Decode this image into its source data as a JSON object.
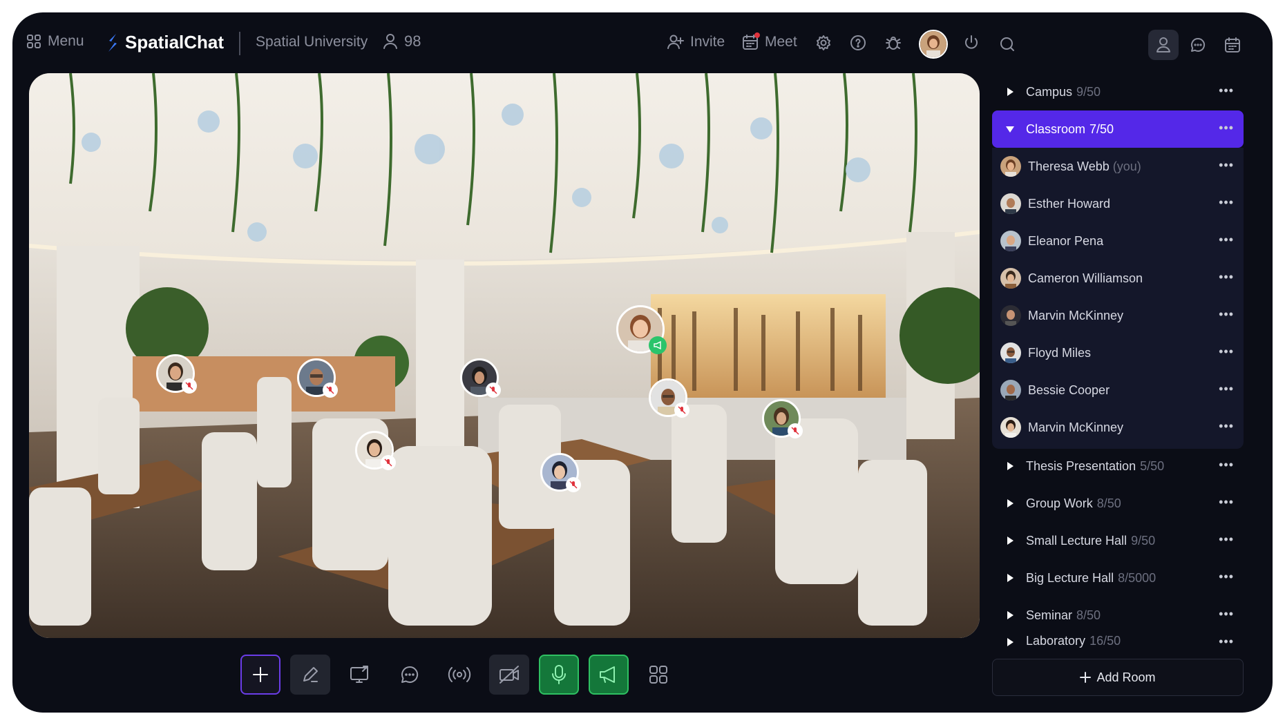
{
  "topbar": {
    "menu_label": "Menu",
    "brand": "SpatialChat",
    "space_name": "Spatial University",
    "participant_count": "98",
    "invite_label": "Invite",
    "meet_label": "Meet"
  },
  "icons": {
    "menu": "grid-icon",
    "brand": "spatialchat-logo-icon",
    "participants": "user-icon",
    "invite": "user-plus-icon",
    "meet": "calendar-icon",
    "settings": "gear-icon",
    "help": "help-icon",
    "bug": "bug-icon",
    "power": "power-icon",
    "search": "search-icon"
  },
  "colors": {
    "accent": "#5428e8",
    "app_bg": "#0b0d16",
    "mic_on": "#2fc062",
    "muted": "#e0323c"
  },
  "sidebar": {
    "rooms_before": [
      {
        "name": "Campus",
        "count": "9/50"
      }
    ],
    "active_room": {
      "name": "Classroom",
      "count": "7/50"
    },
    "members": [
      {
        "name": "Theresa Webb",
        "suffix": "(you)"
      },
      {
        "name": "Esther Howard",
        "suffix": ""
      },
      {
        "name": "Eleanor Pena",
        "suffix": ""
      },
      {
        "name": "Cameron Williamson",
        "suffix": ""
      },
      {
        "name": "Marvin McKinney",
        "suffix": ""
      },
      {
        "name": "Floyd Miles",
        "suffix": ""
      },
      {
        "name": "Bessie Cooper",
        "suffix": ""
      },
      {
        "name": "Marvin McKinney",
        "suffix": ""
      }
    ],
    "rooms_after": [
      {
        "name": "Thesis Presentation",
        "count": "5/50"
      },
      {
        "name": "Group Work",
        "count": "8/50"
      },
      {
        "name": "Small Lecture Hall",
        "count": "9/50"
      },
      {
        "name": "Big Lecture Hall",
        "count": "8/5000"
      },
      {
        "name": "Seminar",
        "count": "8/50"
      },
      {
        "name": "Laboratory",
        "count": "16/50"
      }
    ],
    "more_glyph": "•••",
    "add_room_label": "Add Room"
  },
  "toolbar": {
    "tools": [
      "plus-icon",
      "pencil-icon",
      "screen-share-icon",
      "chat-icon",
      "broadcast-icon",
      "camera-off-icon",
      "microphone-icon",
      "megaphone-icon",
      "apps-grid-icon"
    ]
  }
}
